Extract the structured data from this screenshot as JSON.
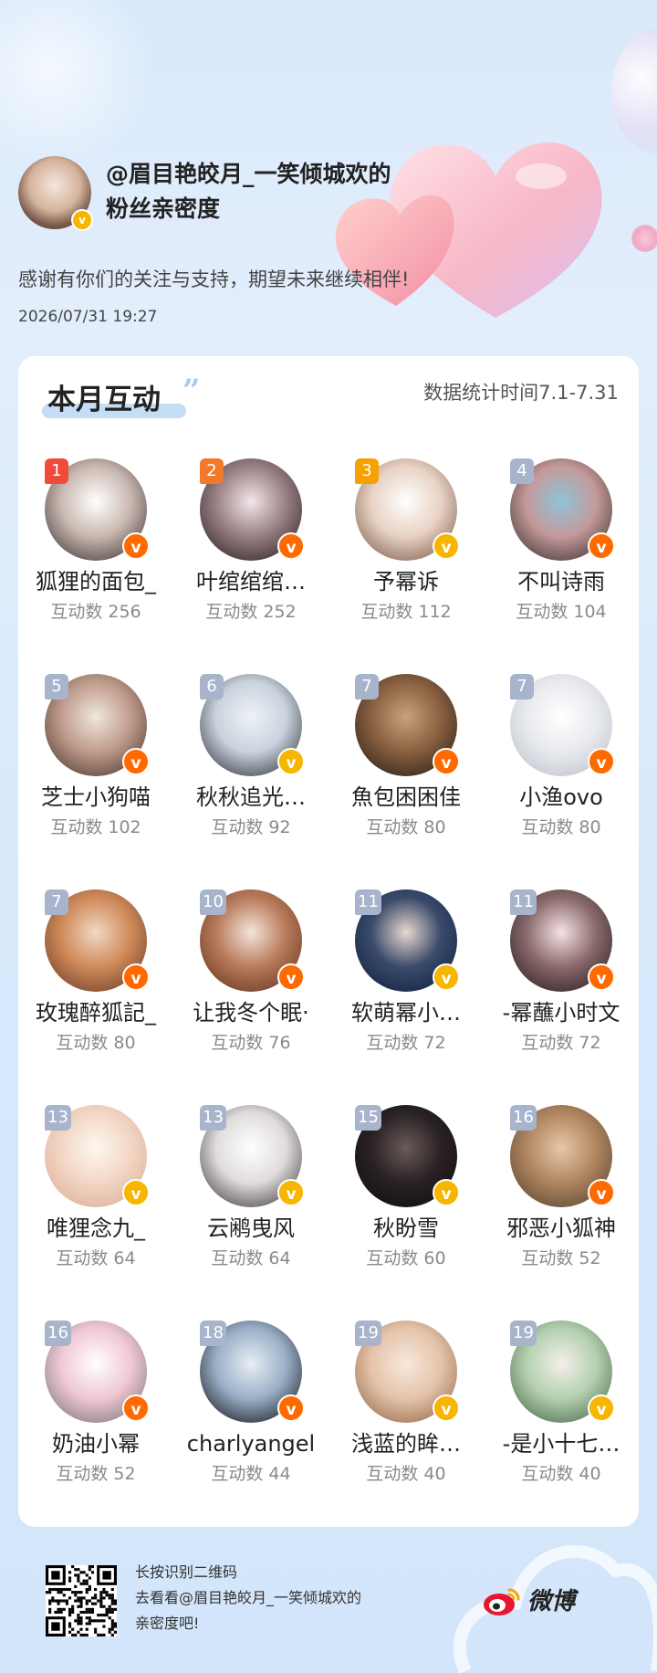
{
  "header": {
    "title": "@眉目艳皎月_一笑倾城欢的粉丝亲密度",
    "thanks": "感谢有你们的关注与支持，期望未来继续相伴!",
    "date": "2026/07/31  19:27",
    "verified_badge": "v"
  },
  "card": {
    "title": "本月互动",
    "quote_mark": "”",
    "stat_time": "数据统计时间7.1-7.31",
    "count_prefix": "互动数"
  },
  "fans": [
    {
      "rank": "1",
      "name": "狐狸的面包_",
      "count": "互动数 256",
      "rank_color": "#f04a3a",
      "badge_color": "#ff6a00",
      "avatar": [
        "#ffffff",
        "#c9b8b0",
        "#2a2226"
      ]
    },
    {
      "rank": "2",
      "name": "叶绾绾绾…",
      "count": "互动数 252",
      "rank_color": "#f07a2a",
      "badge_color": "#ff6a00",
      "avatar": [
        "#f2e7e9",
        "#9a8084",
        "#1a1416"
      ]
    },
    {
      "rank": "3",
      "name": "予幂诉",
      "count": "互动数 112",
      "rank_color": "#f5a100",
      "badge_color": "#f7b500",
      "avatar": [
        "#ffffff",
        "#e8d2c4",
        "#6b4a3a"
      ]
    },
    {
      "rank": "4",
      "name": "不叫诗雨",
      "count": "互动数 104",
      "rank_color": "#a8b4cc",
      "badge_color": "#ff6a00",
      "avatar": [
        "#8ec4d8",
        "#c49a9a",
        "#2a2020"
      ]
    },
    {
      "rank": "5",
      "name": "芝士小狗喵",
      "count": "互动数 102",
      "rank_color": "#a8b4cc",
      "badge_color": "#ff6a00",
      "avatar": [
        "#f1e6dd",
        "#bf9c8c",
        "#3b2a22"
      ]
    },
    {
      "rank": "6",
      "name": "秋秋追光…",
      "count": "互动数 92",
      "rank_color": "#a8b4cc",
      "badge_color": "#f7b500",
      "avatar": [
        "#eef2f6",
        "#c9d3dd",
        "#1a1a22"
      ]
    },
    {
      "rank": "7",
      "name": "魚包困困佳",
      "count": "互动数 80",
      "rank_color": "#a8b4cc",
      "badge_color": "#ff6a00",
      "avatar": [
        "#c9a27a",
        "#8a6040",
        "#1a1412"
      ]
    },
    {
      "rank": "7",
      "name": "小渔ovo",
      "count": "互动数 80",
      "rank_color": "#a8b4cc",
      "badge_color": "#ff6a00",
      "avatar": [
        "#ffffff",
        "#e8eaee",
        "#b8bcc6"
      ]
    },
    {
      "rank": "7",
      "name": "玫瑰醉狐記_",
      "count": "互动数 80",
      "rank_color": "#a8b4cc",
      "badge_color": "#ff6a00",
      "avatar": [
        "#f0d8c4",
        "#d08a5a",
        "#5a3220"
      ]
    },
    {
      "rank": "10",
      "name": "让我冬个眠·",
      "count": "互动数 76",
      "rank_color": "#a8b4cc",
      "badge_color": "#ff6a00",
      "avatar": [
        "#f4e4da",
        "#b87a5a",
        "#5a2a18"
      ]
    },
    {
      "rank": "11",
      "name": "软萌幂小…",
      "count": "互动数 72",
      "rank_color": "#a8b4cc",
      "badge_color": "#f7b500",
      "avatar": [
        "#e8d8d0",
        "#3a4a6a",
        "#0a1a3a"
      ]
    },
    {
      "rank": "11",
      "name": "-幂蘸小时文",
      "count": "互动数 72",
      "rank_color": "#a8b4cc",
      "badge_color": "#ff6a00",
      "avatar": [
        "#f6e2e4",
        "#8a6a6c",
        "#1a1214"
      ]
    },
    {
      "rank": "13",
      "name": "唯狸念九_",
      "count": "互动数 64",
      "rank_color": "#a8b4cc",
      "badge_color": "#f7b500",
      "avatar": [
        "#fff8f0",
        "#f2d6c4",
        "#d8a890"
      ]
    },
    {
      "rank": "13",
      "name": "云鹇曳风",
      "count": "互动数 64",
      "rank_color": "#a8b4cc",
      "badge_color": "#f7b500",
      "avatar": [
        "#ffffff",
        "#e0dcdc",
        "#2a2222"
      ]
    },
    {
      "rank": "15",
      "name": "秋盼雪",
      "count": "互动数 60",
      "rank_color": "#a8b4cc",
      "badge_color": "#f7b500",
      "avatar": [
        "#6a5a5a",
        "#2a2224",
        "#0a0a0c"
      ]
    },
    {
      "rank": "16",
      "name": "邪恶小狐神",
      "count": "互动数 52",
      "rank_color": "#a8b4cc",
      "badge_color": "#ff6a00",
      "avatar": [
        "#e8c8a8",
        "#b08660",
        "#4a3a2a"
      ]
    },
    {
      "rank": "16",
      "name": "奶油小幂",
      "count": "互动数 52",
      "rank_color": "#a8b4cc",
      "badge_color": "#ff6a00",
      "avatar": [
        "#ffffff",
        "#f0c8d4",
        "#6a6a6a"
      ]
    },
    {
      "rank": "18",
      "name": "charlyangel",
      "count": "互动数 44",
      "rank_color": "#a8b4cc",
      "badge_color": "#ff6a00",
      "avatar": [
        "#e8eef4",
        "#9ab0c8",
        "#000000"
      ]
    },
    {
      "rank": "19",
      "name": "浅蓝的眸…",
      "count": "互动数 40",
      "rank_color": "#a8b4cc",
      "badge_color": "#f7b500",
      "avatar": [
        "#f8e8dc",
        "#e4c4aa",
        "#8a5a3a"
      ]
    },
    {
      "rank": "19",
      "name": "-是小十七…",
      "count": "互动数 40",
      "rank_color": "#a8b4cc",
      "badge_color": "#f7b500",
      "avatar": [
        "#f4f0ea",
        "#b4d0b0",
        "#3a5a3a"
      ]
    }
  ],
  "footer": {
    "line1": "长按识别二维码",
    "line2": "去看看@眉目艳皎月_一笑倾城欢的",
    "line3": "亲密度吧!",
    "brand": "微博",
    "brand_icon": "weibo-logo-icon"
  }
}
